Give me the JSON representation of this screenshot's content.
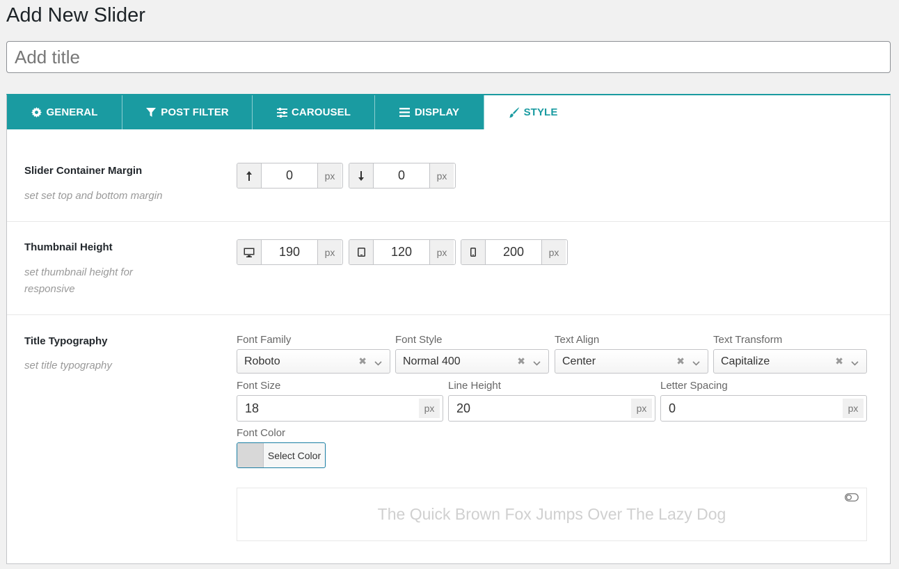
{
  "page": {
    "title": "Add New Slider"
  },
  "title_input": {
    "placeholder": "Add title"
  },
  "tabs": [
    {
      "label": "GENERAL",
      "icon": "gear-icon"
    },
    {
      "label": "POST FILTER",
      "icon": "filter-icon"
    },
    {
      "label": "CAROUSEL",
      "icon": "sliders-icon"
    },
    {
      "label": "DISPLAY",
      "icon": "list-icon"
    },
    {
      "label": "STYLE",
      "icon": "brush-icon",
      "active": true
    }
  ],
  "margin_row": {
    "label": "Slider Container Margin",
    "desc": "set set top and bottom margin",
    "top": {
      "icon": "arrow-up-icon",
      "value": "0",
      "unit": "px"
    },
    "bottom": {
      "icon": "arrow-down-icon",
      "value": "0",
      "unit": "px"
    }
  },
  "thumb_row": {
    "label": "Thumbnail Height",
    "desc": "set thumbnail height for responsive",
    "desktop": {
      "icon": "desktop-icon",
      "value": "190",
      "unit": "px"
    },
    "tablet": {
      "icon": "tablet-icon",
      "value": "120",
      "unit": "px"
    },
    "mobile": {
      "icon": "mobile-icon",
      "value": "200",
      "unit": "px"
    }
  },
  "typo_row": {
    "label": "Title Typography",
    "desc": "set title typography",
    "font_family": {
      "label": "Font Family",
      "value": "Roboto"
    },
    "font_style": {
      "label": "Font Style",
      "value": "Normal 400"
    },
    "text_align": {
      "label": "Text Align",
      "value": "Center"
    },
    "text_transform": {
      "label": "Text Transform",
      "value": "Capitalize"
    },
    "font_size": {
      "label": "Font Size",
      "value": "18",
      "unit": "px"
    },
    "line_height": {
      "label": "Line Height",
      "value": "20",
      "unit": "px"
    },
    "letter_spacing": {
      "label": "Letter Spacing",
      "value": "0",
      "unit": "px"
    },
    "font_color": {
      "label": "Font Color",
      "button": "Select Color",
      "swatch": "#d8d8d8"
    },
    "preview_text": "The Quick Brown Fox Jumps Over The Lazy Dog",
    "clear_symbol": "✖"
  },
  "colors": {
    "accent": "#1a9ba1"
  }
}
